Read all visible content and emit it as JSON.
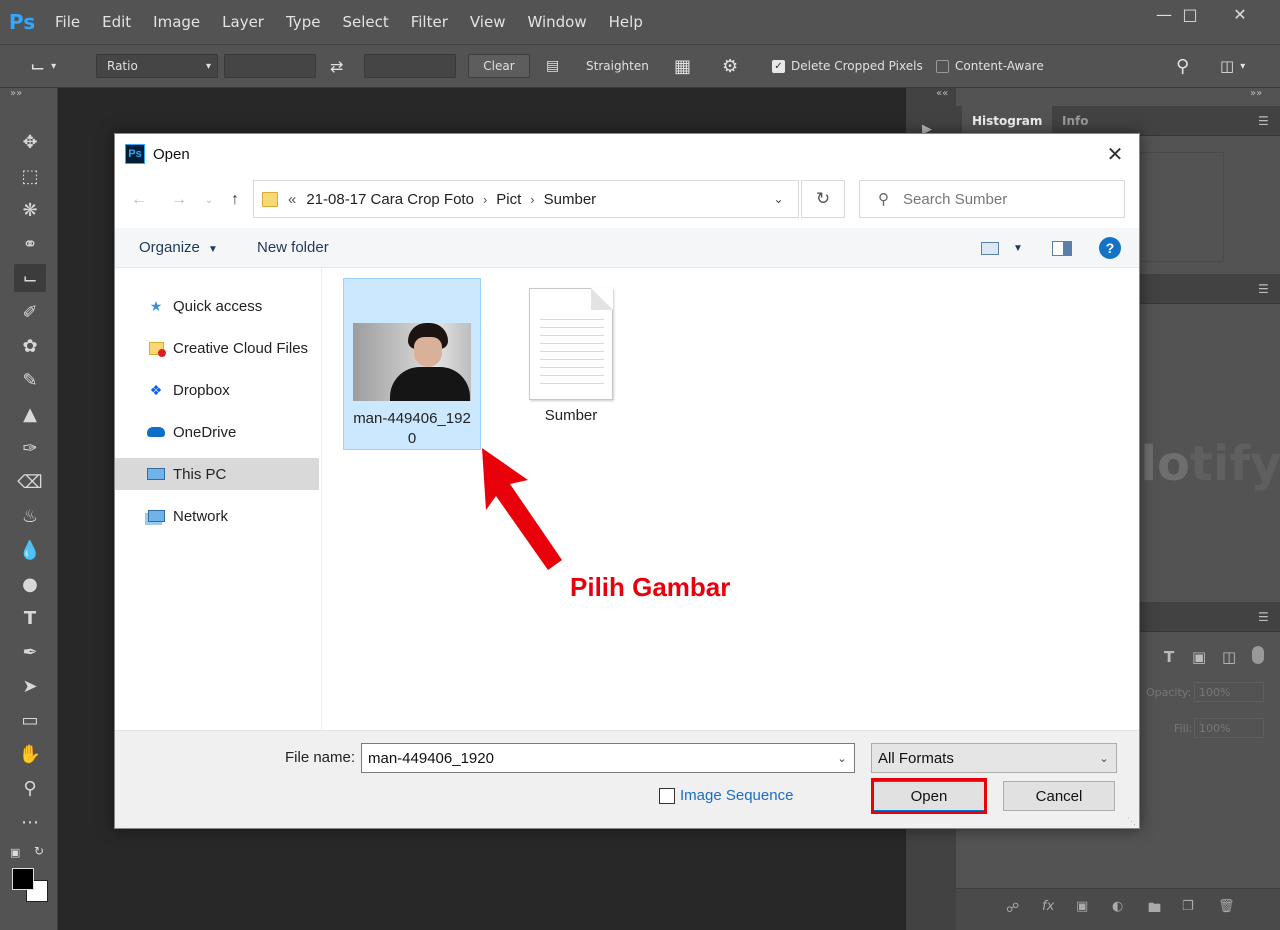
{
  "app": {
    "logo": "Ps",
    "menu": [
      "File",
      "Edit",
      "Image",
      "Layer",
      "Type",
      "Select",
      "Filter",
      "View",
      "Window",
      "Help"
    ],
    "window_controls": [
      "minimize-icon",
      "maximize-icon",
      "close-icon"
    ]
  },
  "options_bar": {
    "ratio_select": "Ratio",
    "clear_label": "Clear",
    "straighten_label": "Straighten",
    "delete_cropped_label": "Delete Cropped Pixels",
    "delete_cropped_checked": true,
    "content_aware_label": "Content-Aware",
    "content_aware_checked": false
  },
  "panels": {
    "collapse_glyph": "««",
    "expand_glyph": "»»",
    "tabs": [
      "Histogram",
      "Info"
    ],
    "layer_opacity_label": "Opacity:",
    "layer_opacity_value": "100%",
    "layer_fill_label": "Fill:",
    "layer_fill_value": "100%"
  },
  "watermark": {
    "part1": "uplo",
    "part2": "tify"
  },
  "dialog": {
    "title": "Open",
    "breadcrumb": {
      "overflow": "«",
      "items": [
        "21-08-17 Cara Crop Foto",
        "Pict",
        "Sumber"
      ]
    },
    "search_placeholder": "Search Sumber",
    "commands": {
      "organize": "Organize",
      "new_folder": "New folder"
    },
    "nav_items": [
      {
        "label": "Quick access",
        "icon": "star-icon"
      },
      {
        "label": "Creative Cloud Files",
        "icon": "creative-cloud-folder-icon"
      },
      {
        "label": "Dropbox",
        "icon": "dropbox-icon"
      },
      {
        "label": "OneDrive",
        "icon": "onedrive-cloud-icon"
      },
      {
        "label": "This PC",
        "icon": "computer-icon",
        "selected": true
      },
      {
        "label": "Network",
        "icon": "network-icon"
      }
    ],
    "files": [
      {
        "name": "man-449406_1920",
        "type": "image",
        "selected": true
      },
      {
        "name": "Sumber",
        "type": "document",
        "selected": false
      }
    ],
    "file_name_label": "File name:",
    "file_name_value": "man-449406_1920",
    "format_value": "All Formats",
    "image_sequence_label": "Image Sequence",
    "open_label": "Open",
    "cancel_label": "Cancel"
  },
  "annotation": {
    "text": "Pilih Gambar",
    "color": "#e8000b"
  },
  "colors": {
    "ps_blue": "#31a8ff",
    "ui_dark": "#535353",
    "canvas": "#282828",
    "selection": "#cce8ff"
  }
}
